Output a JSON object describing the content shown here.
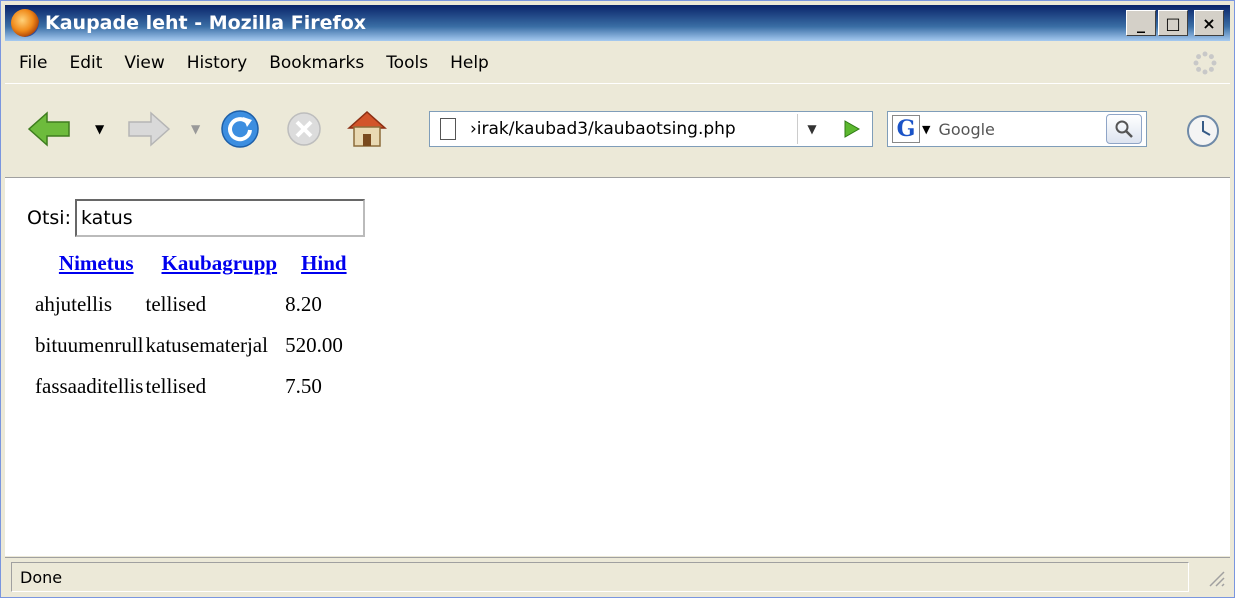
{
  "window": {
    "title": "Kaupade leht - Mozilla Firefox",
    "minimize_label": "_",
    "maximize_label": "□",
    "close_label": "×"
  },
  "menu": {
    "items": [
      "File",
      "Edit",
      "View",
      "History",
      "Bookmarks",
      "Tools",
      "Help"
    ]
  },
  "toolbar": {
    "url": "›irak/kaubad3/kaubaotsing.php",
    "search_placeholder": "Google",
    "search_engine_letter": "G"
  },
  "page": {
    "search_label": "Otsi:",
    "search_value": "katus",
    "table": {
      "headers": [
        "Nimetus",
        "Kaubagrupp",
        "Hind"
      ],
      "rows": [
        [
          "ahjutellis",
          "tellised",
          "8.20"
        ],
        [
          "bituumenrull",
          "katusematerjal",
          "520.00"
        ],
        [
          "fassaaditellis",
          "tellised",
          "7.50"
        ]
      ]
    }
  },
  "status": {
    "text": "Done"
  },
  "icons": {
    "back": "back-arrow-icon",
    "forward": "forward-arrow-icon",
    "reload": "reload-icon",
    "stop": "stop-icon",
    "home": "home-icon",
    "go": "go-arrow-icon",
    "search": "magnifier-icon",
    "clock": "clock-icon"
  },
  "colors": {
    "titlebar": "#0a246a",
    "link": "#0000ee",
    "chrome": "#ece9d8"
  }
}
